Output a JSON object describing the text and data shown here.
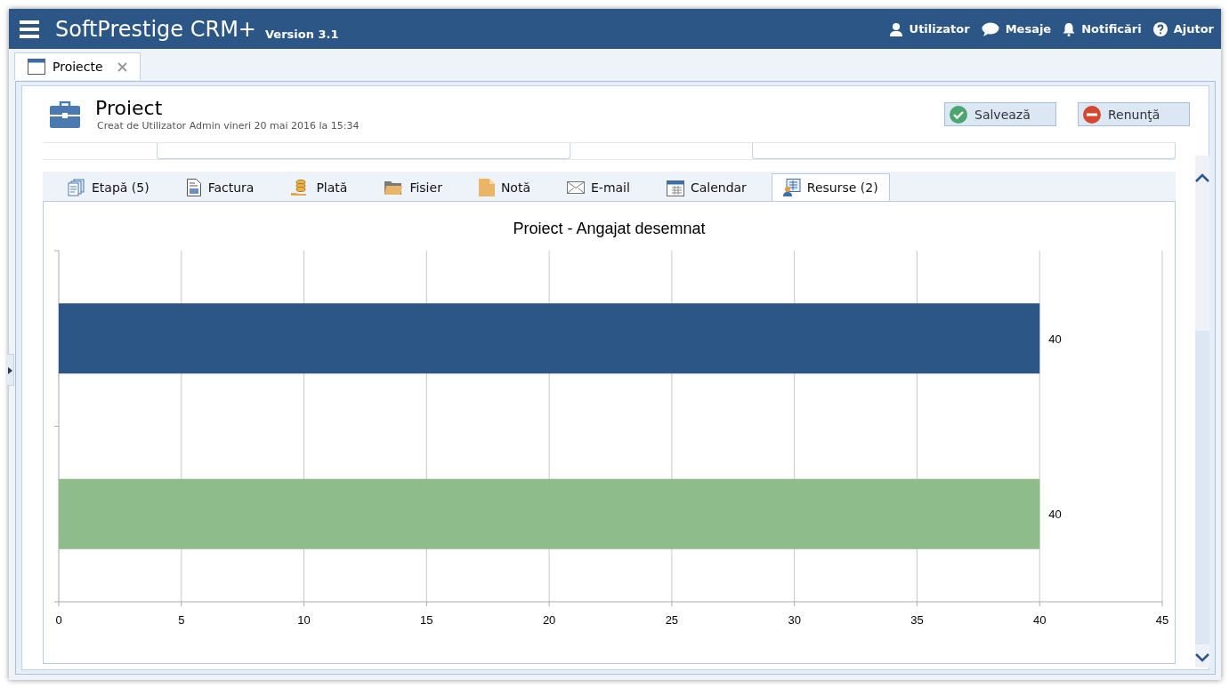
{
  "app": {
    "title": "SoftPrestige CRM+",
    "version": "Version 3.1"
  },
  "header_menu": [
    {
      "label": "Utilizator",
      "kind": "user"
    },
    {
      "label": "Mesaje",
      "kind": "chat"
    },
    {
      "label": "Notificări",
      "kind": "bell"
    },
    {
      "label": "Ajutor",
      "kind": "help"
    }
  ],
  "doc_tabs": [
    {
      "label": "Proiecte",
      "selected": true
    }
  ],
  "record": {
    "title": "Proiect",
    "subtitle": "Creat de Utilizator Admin vineri 20 mai 2016 la 15:34",
    "buttons": [
      {
        "label": "Salvează",
        "kind": "save"
      },
      {
        "label": "Renunţă",
        "kind": "cancel"
      }
    ]
  },
  "tabs": [
    {
      "label": "Etapă (5)",
      "kind": "stages",
      "selected": false
    },
    {
      "label": "Factura",
      "kind": "invoice",
      "selected": false
    },
    {
      "label": "Plată",
      "kind": "payment",
      "selected": false
    },
    {
      "label": "Fisier",
      "kind": "folder",
      "selected": false
    },
    {
      "label": "Notă",
      "kind": "note",
      "selected": false
    },
    {
      "label": "E-mail",
      "kind": "mail",
      "selected": false
    },
    {
      "label": "Calendar",
      "kind": "calendar",
      "selected": false
    },
    {
      "label": "Resurse (2)",
      "kind": "resources",
      "selected": true
    }
  ],
  "chart_data": {
    "type": "bar",
    "title": "Proiect - Angajat desemnat",
    "orientation": "horizontal",
    "grid": true,
    "data_labels": true,
    "xlim": [
      0,
      45
    ],
    "xticks": [
      0,
      5,
      10,
      15,
      20,
      25,
      30,
      35,
      40,
      45
    ],
    "series": [
      {
        "color": "#2b5685",
        "values": [
          40
        ]
      },
      {
        "color": "#8fbc8b",
        "values": [
          40
        ]
      }
    ]
  }
}
